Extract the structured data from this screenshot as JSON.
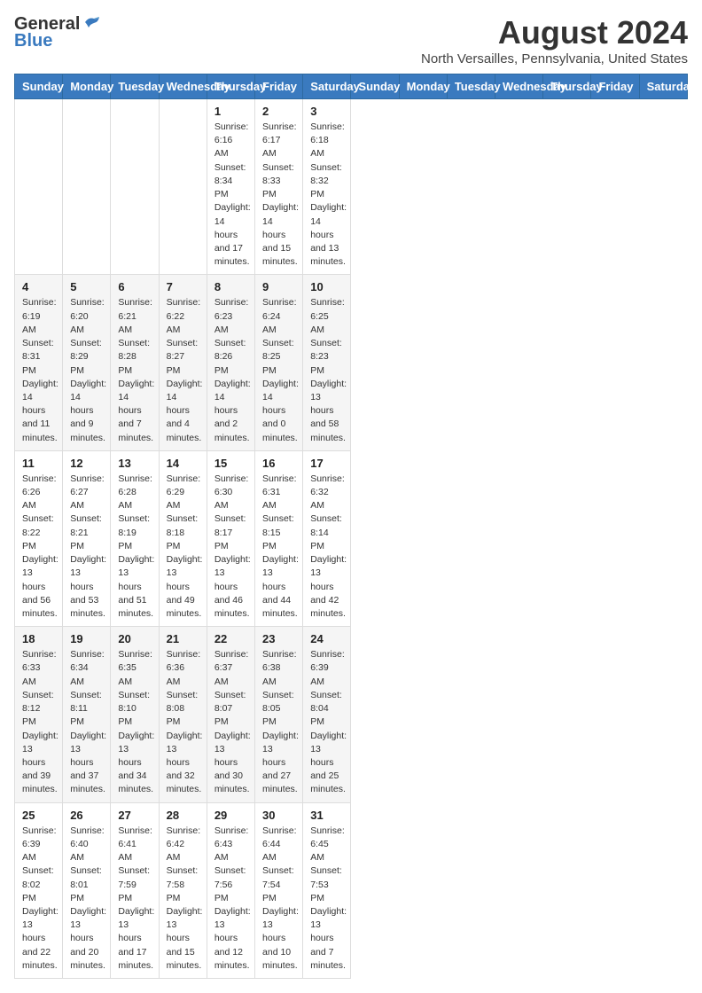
{
  "header": {
    "logo_general": "General",
    "logo_blue": "Blue",
    "month_title": "August 2024",
    "location": "North Versailles, Pennsylvania, United States"
  },
  "days_of_week": [
    "Sunday",
    "Monday",
    "Tuesday",
    "Wednesday",
    "Thursday",
    "Friday",
    "Saturday"
  ],
  "weeks": [
    [
      {
        "day": "",
        "info": ""
      },
      {
        "day": "",
        "info": ""
      },
      {
        "day": "",
        "info": ""
      },
      {
        "day": "",
        "info": ""
      },
      {
        "day": "1",
        "info": "Sunrise: 6:16 AM\nSunset: 8:34 PM\nDaylight: 14 hours\nand 17 minutes."
      },
      {
        "day": "2",
        "info": "Sunrise: 6:17 AM\nSunset: 8:33 PM\nDaylight: 14 hours\nand 15 minutes."
      },
      {
        "day": "3",
        "info": "Sunrise: 6:18 AM\nSunset: 8:32 PM\nDaylight: 14 hours\nand 13 minutes."
      }
    ],
    [
      {
        "day": "4",
        "info": "Sunrise: 6:19 AM\nSunset: 8:31 PM\nDaylight: 14 hours\nand 11 minutes."
      },
      {
        "day": "5",
        "info": "Sunrise: 6:20 AM\nSunset: 8:29 PM\nDaylight: 14 hours\nand 9 minutes."
      },
      {
        "day": "6",
        "info": "Sunrise: 6:21 AM\nSunset: 8:28 PM\nDaylight: 14 hours\nand 7 minutes."
      },
      {
        "day": "7",
        "info": "Sunrise: 6:22 AM\nSunset: 8:27 PM\nDaylight: 14 hours\nand 4 minutes."
      },
      {
        "day": "8",
        "info": "Sunrise: 6:23 AM\nSunset: 8:26 PM\nDaylight: 14 hours\nand 2 minutes."
      },
      {
        "day": "9",
        "info": "Sunrise: 6:24 AM\nSunset: 8:25 PM\nDaylight: 14 hours\nand 0 minutes."
      },
      {
        "day": "10",
        "info": "Sunrise: 6:25 AM\nSunset: 8:23 PM\nDaylight: 13 hours\nand 58 minutes."
      }
    ],
    [
      {
        "day": "11",
        "info": "Sunrise: 6:26 AM\nSunset: 8:22 PM\nDaylight: 13 hours\nand 56 minutes."
      },
      {
        "day": "12",
        "info": "Sunrise: 6:27 AM\nSunset: 8:21 PM\nDaylight: 13 hours\nand 53 minutes."
      },
      {
        "day": "13",
        "info": "Sunrise: 6:28 AM\nSunset: 8:19 PM\nDaylight: 13 hours\nand 51 minutes."
      },
      {
        "day": "14",
        "info": "Sunrise: 6:29 AM\nSunset: 8:18 PM\nDaylight: 13 hours\nand 49 minutes."
      },
      {
        "day": "15",
        "info": "Sunrise: 6:30 AM\nSunset: 8:17 PM\nDaylight: 13 hours\nand 46 minutes."
      },
      {
        "day": "16",
        "info": "Sunrise: 6:31 AM\nSunset: 8:15 PM\nDaylight: 13 hours\nand 44 minutes."
      },
      {
        "day": "17",
        "info": "Sunrise: 6:32 AM\nSunset: 8:14 PM\nDaylight: 13 hours\nand 42 minutes."
      }
    ],
    [
      {
        "day": "18",
        "info": "Sunrise: 6:33 AM\nSunset: 8:12 PM\nDaylight: 13 hours\nand 39 minutes."
      },
      {
        "day": "19",
        "info": "Sunrise: 6:34 AM\nSunset: 8:11 PM\nDaylight: 13 hours\nand 37 minutes."
      },
      {
        "day": "20",
        "info": "Sunrise: 6:35 AM\nSunset: 8:10 PM\nDaylight: 13 hours\nand 34 minutes."
      },
      {
        "day": "21",
        "info": "Sunrise: 6:36 AM\nSunset: 8:08 PM\nDaylight: 13 hours\nand 32 minutes."
      },
      {
        "day": "22",
        "info": "Sunrise: 6:37 AM\nSunset: 8:07 PM\nDaylight: 13 hours\nand 30 minutes."
      },
      {
        "day": "23",
        "info": "Sunrise: 6:38 AM\nSunset: 8:05 PM\nDaylight: 13 hours\nand 27 minutes."
      },
      {
        "day": "24",
        "info": "Sunrise: 6:39 AM\nSunset: 8:04 PM\nDaylight: 13 hours\nand 25 minutes."
      }
    ],
    [
      {
        "day": "25",
        "info": "Sunrise: 6:39 AM\nSunset: 8:02 PM\nDaylight: 13 hours\nand 22 minutes."
      },
      {
        "day": "26",
        "info": "Sunrise: 6:40 AM\nSunset: 8:01 PM\nDaylight: 13 hours\nand 20 minutes."
      },
      {
        "day": "27",
        "info": "Sunrise: 6:41 AM\nSunset: 7:59 PM\nDaylight: 13 hours\nand 17 minutes."
      },
      {
        "day": "28",
        "info": "Sunrise: 6:42 AM\nSunset: 7:58 PM\nDaylight: 13 hours\nand 15 minutes."
      },
      {
        "day": "29",
        "info": "Sunrise: 6:43 AM\nSunset: 7:56 PM\nDaylight: 13 hours\nand 12 minutes."
      },
      {
        "day": "30",
        "info": "Sunrise: 6:44 AM\nSunset: 7:54 PM\nDaylight: 13 hours\nand 10 minutes."
      },
      {
        "day": "31",
        "info": "Sunrise: 6:45 AM\nSunset: 7:53 PM\nDaylight: 13 hours\nand 7 minutes."
      }
    ]
  ]
}
